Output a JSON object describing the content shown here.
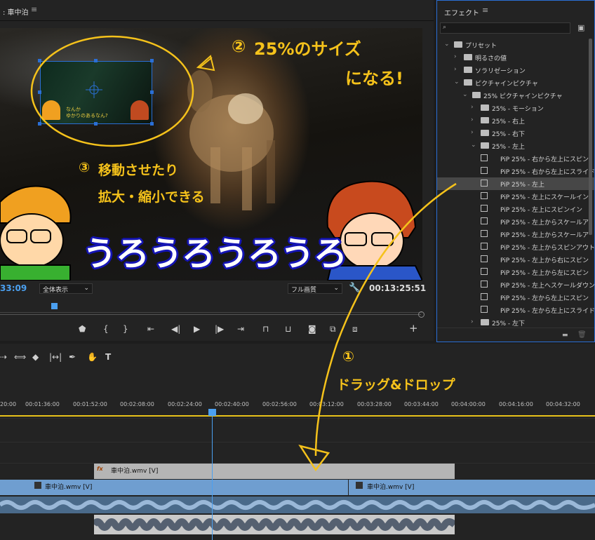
{
  "monitor": {
    "title": ": 車中泊",
    "menu_glyph": "≡",
    "timecode_left": "33:09",
    "fit_select": "全体表示",
    "quality_select": "フル画質",
    "timecode_right": "00:13:25:51",
    "big_text": "うろうろうろうろ",
    "pip_caption": "なんか\nゆかりのあるなん?"
  },
  "annotations": {
    "note2_num": "②",
    "note2_line1": "25%のサイズ",
    "note2_line2": "になる!",
    "note3_num": "③",
    "note3_line1": "移動させたり",
    "note3_line2": "拡大・縮小できる",
    "note1_num": "①",
    "note1_text": "ドラッグ&ドロップ",
    "note_color": "#f5c21b"
  },
  "effects_panel": {
    "title": "エフェクト",
    "menu_glyph": "≡",
    "search_icon": "search-icon",
    "items": [
      {
        "label": "プリセット",
        "type": "folder",
        "expanded": true,
        "level": 0
      },
      {
        "label": "明るさの値",
        "type": "folder",
        "expanded": false,
        "level": 1
      },
      {
        "label": "ソラリゼーション",
        "type": "folder",
        "expanded": false,
        "level": 1
      },
      {
        "label": "ピクチャインピクチャ",
        "type": "folder",
        "expanded": true,
        "level": 1
      },
      {
        "label": "25% ピクチャインピクチャ",
        "type": "folder",
        "expanded": true,
        "level": 2
      },
      {
        "label": "25% - モーション",
        "type": "folder",
        "expanded": false,
        "level": 3
      },
      {
        "label": "25% - 右上",
        "type": "folder",
        "expanded": false,
        "level": 3
      },
      {
        "label": "25% - 右下",
        "type": "folder",
        "expanded": false,
        "level": 3
      },
      {
        "label": "25% - 左上",
        "type": "folder",
        "expanded": true,
        "level": 3
      },
      {
        "label": "PiP 25% - 右から左上にスピン",
        "type": "preset",
        "level": 4
      },
      {
        "label": "PiP 25% - 右から左上にスライド",
        "type": "preset",
        "level": 4
      },
      {
        "label": "PiP 25% - 左上",
        "type": "preset",
        "level": 4,
        "selected": true
      },
      {
        "label": "PiP 25% - 左上にスケールイン",
        "type": "preset",
        "level": 4
      },
      {
        "label": "PiP 25% - 左上にスピンイン",
        "type": "preset",
        "level": 4
      },
      {
        "label": "PiP 25% - 左上からスケールア",
        "type": "preset",
        "level": 4
      },
      {
        "label": "PiP 25% - 左上からスケールア",
        "type": "preset",
        "level": 4
      },
      {
        "label": "PiP 25% - 左上からスピンアウト",
        "type": "preset",
        "level": 4
      },
      {
        "label": "PiP 25% - 左上から右にスピン",
        "type": "preset",
        "level": 4
      },
      {
        "label": "PiP 25% - 左上から左にスピン",
        "type": "preset",
        "level": 4
      },
      {
        "label": "PiP 25% - 左上へスケールダウン",
        "type": "preset",
        "level": 4
      },
      {
        "label": "PiP 25% - 左から左上にスピン",
        "type": "preset",
        "level": 4
      },
      {
        "label": "PiP 25% - 左から左上にスライド",
        "type": "preset",
        "level": 4
      },
      {
        "label": "25% - 左下",
        "type": "folder",
        "expanded": false,
        "level": 3
      }
    ]
  },
  "timeline": {
    "ruler_ticks": [
      "20:00",
      "00:01:36:00",
      "00:01:52:00",
      "00:02:08:00",
      "00:02:24:00",
      "00:02:40:00",
      "00:02:56:00",
      "00:03:12:00",
      "00:03:28:00",
      "00:03:44:00",
      "00:04:00:00",
      "00:04:16:00",
      "00:04:32:00"
    ],
    "clips": {
      "v2": "車中泊.wmv [V]",
      "v1_a": "車中泊.wmv [V]",
      "v1_b": "車中泊.wmv [V]"
    },
    "fx_badge": "fx"
  }
}
